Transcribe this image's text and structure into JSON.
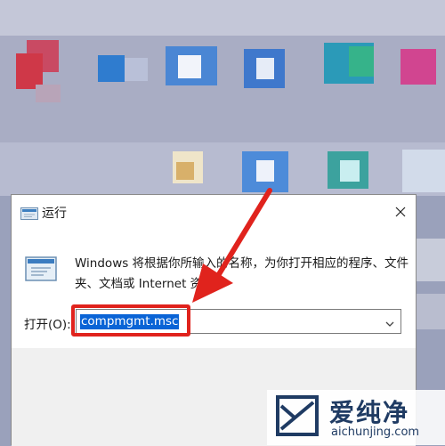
{
  "dialog": {
    "title": "运行",
    "description": "Windows 将根据你所输入的名称，为你打开相应的程序、文件夹、文档或 Internet 资源。",
    "open_label": "打开(O):",
    "command_value": "compmgmt.msc"
  },
  "watermark": {
    "brand_cn": "爱纯净",
    "url": "aichunjing.com"
  },
  "colors": {
    "highlight": "#e0231d",
    "selection": "#0a64d6"
  },
  "icons": {
    "title": "run-icon",
    "large": "run-icon",
    "close": "close-icon",
    "dropdown": "chevron-down-icon"
  }
}
